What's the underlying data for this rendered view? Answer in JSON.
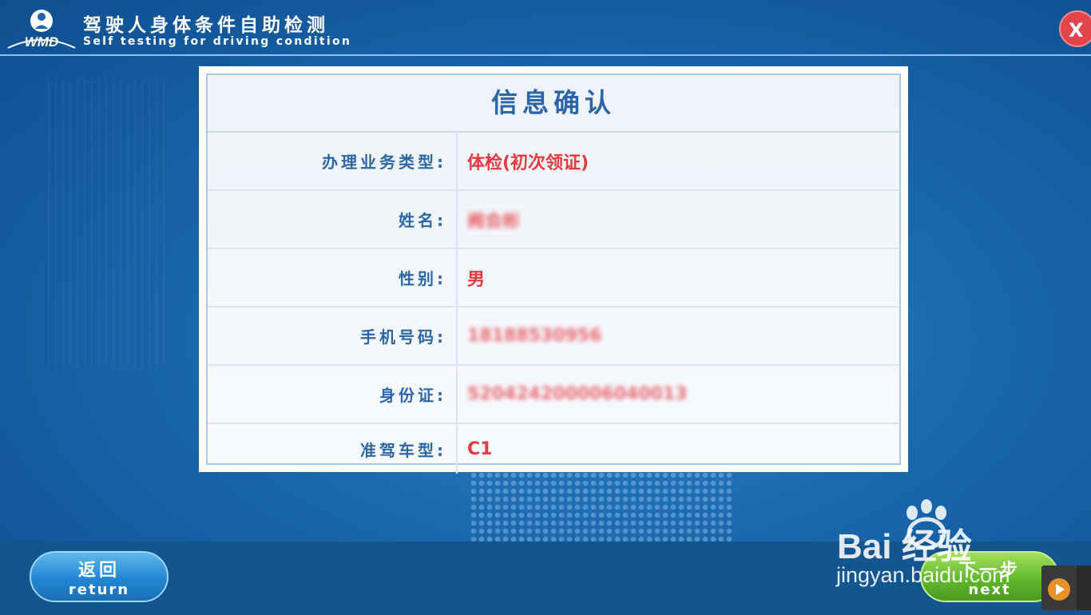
{
  "header": {
    "logo_text": "WMD",
    "title_cn": "驾驶人身体条件自助检测",
    "title_en": "Self testing for driving condition",
    "close_label": "X"
  },
  "card": {
    "title": "信息确认",
    "rows": [
      {
        "label": "办理业务类型:",
        "value": "体检(初次领证)",
        "blurred": false
      },
      {
        "label": "姓名:",
        "value": "阙会彬",
        "blurred": true
      },
      {
        "label": "性别:",
        "value": "男",
        "blurred": false
      },
      {
        "label": "手机号码:",
        "value": "18188530956",
        "blurred": true
      },
      {
        "label": "身份证:",
        "value": "520424200006040013",
        "blurred": true
      },
      {
        "label": "准驾车型:",
        "value": "C1",
        "blurred": false
      }
    ]
  },
  "footer": {
    "return_cn": "返回",
    "return_en": "return",
    "next_cn": "下一步",
    "next_en": "next"
  },
  "watermark": {
    "brand": "Bai 经验",
    "url": "jingyan.baidu.com"
  },
  "colors": {
    "background": "#1a67ad",
    "label": "#2d66a7",
    "value": "#e43a40",
    "close": "#e2454b",
    "return_button": "#2386d2",
    "next_button": "#62b82c"
  },
  "icons": [
    "logo-icon",
    "close-icon",
    "baidu-paw-icon",
    "media-play-icon"
  ]
}
